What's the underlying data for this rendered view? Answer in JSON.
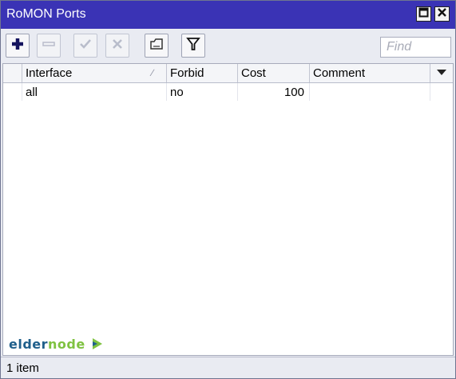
{
  "window": {
    "title": "RoMON Ports",
    "maximize_icon": "maximize-icon",
    "close_icon": "close-icon"
  },
  "toolbar": {
    "buttons": [
      {
        "icon": "plus-icon",
        "enabled": true
      },
      {
        "icon": "minus-icon",
        "enabled": false
      },
      {
        "icon": "check-icon",
        "enabled": false
      },
      {
        "icon": "cross-icon",
        "enabled": false
      },
      {
        "icon": "comment-icon",
        "enabled": true
      },
      {
        "icon": "filter-icon",
        "enabled": true
      }
    ],
    "find_placeholder": "Find"
  },
  "table": {
    "columns": [
      "Interface",
      "Forbid",
      "Cost",
      "Comment"
    ],
    "sorted_column": "Interface",
    "rows": [
      {
        "interface": "all",
        "forbid": "no",
        "cost": "100",
        "comment": ""
      }
    ]
  },
  "watermark": {
    "part1": "elder",
    "part2": "node"
  },
  "status": {
    "text": "1 item"
  },
  "colors": {
    "titlebar": "#3a33b5",
    "accent_plus": "#14135e",
    "watermark_blue": "#1f5f8b",
    "watermark_green": "#7fc241"
  }
}
